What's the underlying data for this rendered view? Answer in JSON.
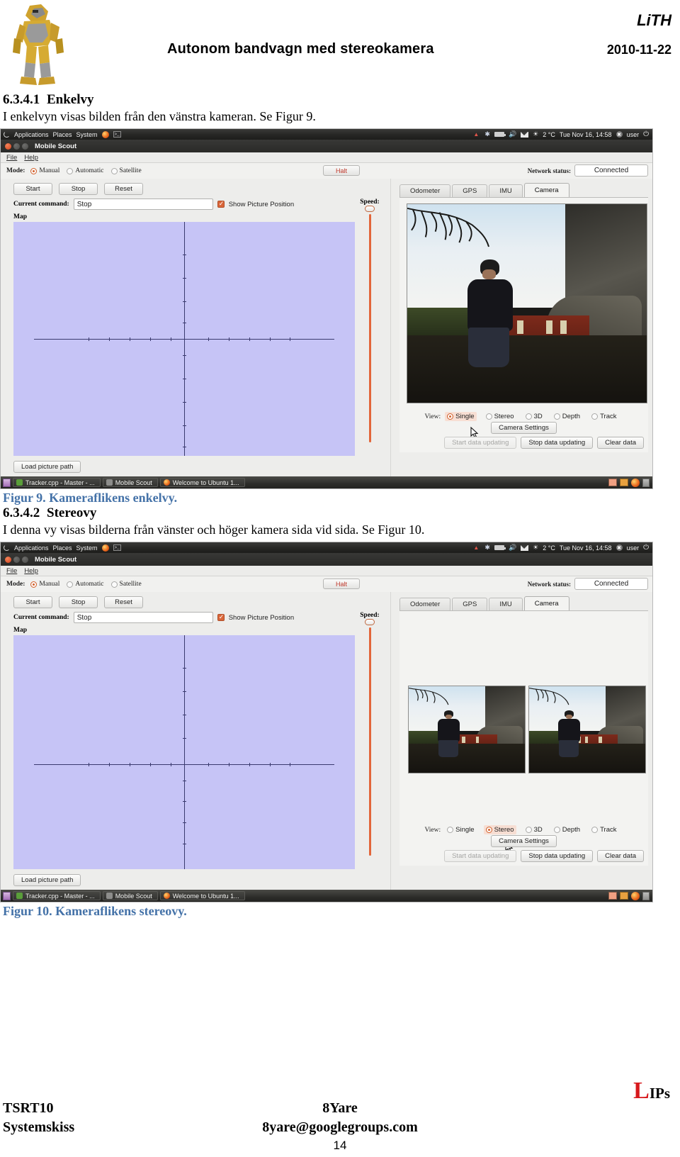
{
  "header": {
    "institution": "LiTH",
    "title": "Autonom bandvagn med stereokamera",
    "date": "2010-11-22",
    "logo_alt": "robot-logo"
  },
  "sections": [
    {
      "number": "6.3.4.1",
      "heading": "Enkelvy",
      "body": "I enkelvyn visas bilden från den vänstra kameran. Se Figur 9.",
      "caption": "Figur 9. Kameraflikens enkelvy."
    },
    {
      "number": "6.3.4.2",
      "heading": "Stereovy",
      "body": "I denna vy visas bilderna från vänster och höger kamera sida vid sida. Se Figur 10.",
      "caption": "Figur 10. Kameraflikens stereovy."
    }
  ],
  "app": {
    "gnome_panel": {
      "menus": [
        "Applications",
        "Places",
        "System"
      ],
      "launcher_icons": [
        "firefox-icon",
        "terminal-icon"
      ],
      "status_icons": [
        "wifi-icon",
        "bluetooth-icon",
        "battery-icon",
        "volume-icon",
        "mail-icon",
        "brightness-icon"
      ],
      "temperature": "2 °C",
      "clock": "Tue Nov 16, 14:58",
      "user": "user",
      "power_icon": "power-icon"
    },
    "window_title": "Mobile Scout",
    "menubar": [
      "File",
      "Help"
    ],
    "mode": {
      "label": "Mode:",
      "options": [
        "Manual",
        "Automatic",
        "Satellite"
      ],
      "selected": "Manual"
    },
    "halt_button": "Halt",
    "network": {
      "label": "Network status:",
      "value": "Connected"
    },
    "control_buttons": [
      "Start",
      "Stop",
      "Reset"
    ],
    "current_command": {
      "label": "Current command:",
      "value": "Stop"
    },
    "show_picture_position": {
      "label": "Show Picture Position",
      "checked": true
    },
    "map_label": "Map",
    "speed_label": "Speed:",
    "load_picture_path": "Load picture path",
    "tabs": [
      "Odometer",
      "GPS",
      "IMU",
      "Camera"
    ],
    "active_tab": "Camera",
    "view": {
      "label": "View:",
      "options": [
        "Single",
        "Stereo",
        "3D",
        "Depth",
        "Track"
      ],
      "selected_single": "Single",
      "selected_stereo": "Stereo"
    },
    "camera_settings_button": "Camera Settings",
    "data_buttons": [
      {
        "label": "Start data updating",
        "enabled": false
      },
      {
        "label": "Stop data updating",
        "enabled": true
      },
      {
        "label": "Clear data",
        "enabled": true
      }
    ],
    "taskbar": {
      "show_desktop": "show-desktop-icon",
      "items": [
        "Tracker.cpp - Master - ...",
        "Mobile Scout",
        "Welcome to Ubuntu 1..."
      ],
      "right_icons": [
        "workspace-switcher-icon",
        "workspace-2-icon",
        "firefox-icon",
        "trash-icon"
      ]
    }
  },
  "footer": {
    "course": "TSRT10",
    "doc_type": "Systemskiss",
    "group": "8Yare",
    "email": "8yare@googlegroups.com",
    "brand": "IPs",
    "page_number": "14"
  },
  "colors": {
    "accent_orange": "#d2612c",
    "caption_blue": "#4472a8",
    "map_purple": "#c6c4f6",
    "brand_red": "#d7191c"
  }
}
